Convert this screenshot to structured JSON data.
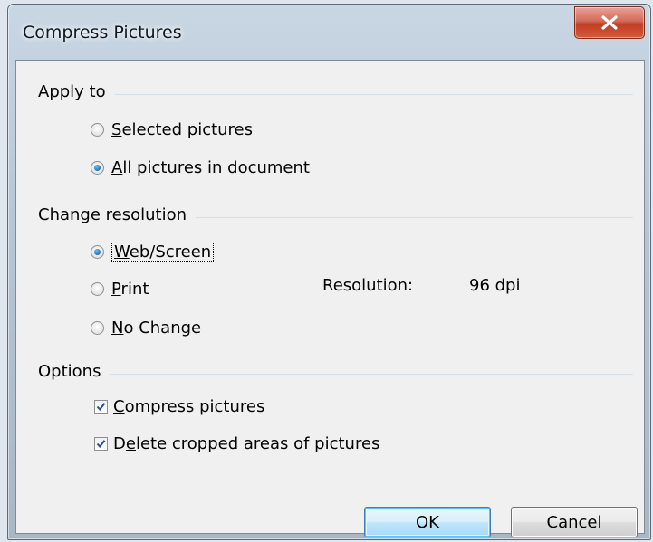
{
  "window": {
    "title": "Compress Pictures"
  },
  "apply_to": {
    "label": "Apply to",
    "options": [
      {
        "label_pre": "",
        "accel": "S",
        "label_post": "elected pictures",
        "selected": false
      },
      {
        "label_pre": "",
        "accel": "A",
        "label_post": "ll pictures in document",
        "selected": true
      }
    ]
  },
  "change_resolution": {
    "label": "Change resolution",
    "options": [
      {
        "label_pre": "",
        "accel": "W",
        "label_post": "eb/Screen",
        "selected": true
      },
      {
        "label_pre": "",
        "accel": "P",
        "label_post": "rint",
        "selected": false
      },
      {
        "label_pre": "",
        "accel": "N",
        "label_post": "o Change",
        "selected": false
      }
    ],
    "resolution_label": "Resolution:",
    "resolution_value": "96 dpi"
  },
  "options": {
    "label": "Options",
    "items": [
      {
        "label_pre": "",
        "accel": "C",
        "label_post": "ompress pictures",
        "checked": true
      },
      {
        "label_pre": "D",
        "accel": "e",
        "label_post": "lete cropped areas of pictures",
        "checked": true
      }
    ]
  },
  "buttons": {
    "ok": "OK",
    "cancel": "Cancel"
  }
}
